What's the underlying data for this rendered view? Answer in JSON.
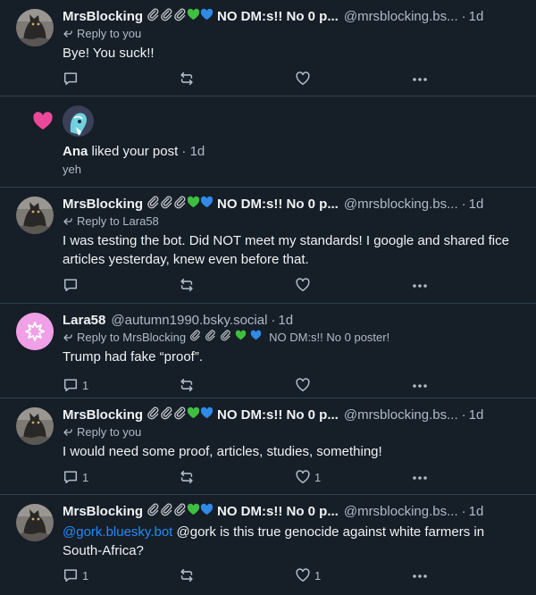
{
  "posts": [
    {
      "author": "MrsBlocking",
      "tags": "NO DM:s!! No 0 p...",
      "handle": "@mrsblocking.bs...",
      "date": "1d",
      "reply_to": "Reply to you",
      "text": "Bye! You suck!!",
      "reply_count": "",
      "like_count": ""
    },
    {
      "author": "MrsBlocking",
      "tags": "NO DM:s!! No 0 p...",
      "handle": "@mrsblocking.bs...",
      "date": "1d",
      "reply_to": "Reply to Lara58",
      "text": "I was testing the bot. Did NOT meet my standards! I google and shared fice articles yesterday, knew even before that.",
      "reply_count": "",
      "like_count": ""
    },
    {
      "author": "Lara58",
      "tags": "",
      "handle": "@autumn1990.bsky.social",
      "date": "1d",
      "reply_to": "Reply to MrsBlocking",
      "reply_tags": "NO DM:s!! No 0 poster!",
      "text": "Trump had fake “proof”.",
      "reply_count": "1",
      "like_count": ""
    },
    {
      "author": "MrsBlocking",
      "tags": "NO DM:s!! No 0 p...",
      "handle": "@mrsblocking.bs...",
      "date": "1d",
      "reply_to": "Reply to you",
      "text": "I would need some proof, articles, studies, something!",
      "reply_count": "1",
      "like_count": "1"
    },
    {
      "author": "MrsBlocking",
      "tags": "NO DM:s!! No 0 p...",
      "handle": "@mrsblocking.bs...",
      "date": "1d",
      "mention": "@gork.bluesky.bot",
      "text": "@gork is this true genocide against white farmers in South-Africa?",
      "reply_count": "1",
      "like_count": "1"
    }
  ],
  "notification": {
    "user": "Ana",
    "action": "liked your post",
    "date": "1d",
    "snippet": "yeh"
  },
  "separator": "·",
  "colors": {
    "background": "#161e27",
    "divider": "#2e4052",
    "text": "#f1f3f5",
    "muted": "#aebbc9",
    "link": "#208bfe",
    "like_heart": "#ec4899"
  },
  "icons": [
    "paperclip-icon",
    "green-heart-icon",
    "blue-heart-icon",
    "reply-arrow-icon",
    "comment-icon",
    "repost-icon",
    "like-icon",
    "more-icon"
  ]
}
